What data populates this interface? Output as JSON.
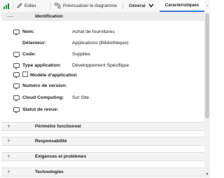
{
  "toolbar": {
    "edit_label": "Editer",
    "preview_label": "Prévisualiser le diagramme",
    "general_label": "Général",
    "characteristics_label": "Caractéristiques",
    "next_arrow": "›"
  },
  "sections": {
    "identification": {
      "title": "Identification",
      "sign": "—"
    },
    "perimetre": {
      "title": "Périmètre fonctionnel",
      "sign": "+"
    },
    "responsabilite": {
      "title": "Responsabilité",
      "sign": "+"
    },
    "exigences": {
      "title": "Exigences et problèmes",
      "sign": "+"
    },
    "technologies": {
      "title": "Technologies",
      "sign": "+"
    }
  },
  "fields": {
    "nom": {
      "label": "Nom:",
      "value": "Achat de fournitures"
    },
    "detenteur": {
      "label": "Détenteur:",
      "value": "Applications  (Bibliothèque)"
    },
    "code": {
      "label": "Code:",
      "value": "Supplies"
    },
    "type": {
      "label": "Type application:",
      "value": "Développement Spécifique"
    },
    "modele": {
      "label": "Modèle d'application",
      "checked": false
    },
    "version": {
      "label": "Numéro de version:",
      "value": ""
    },
    "cloud": {
      "label": "Cloud Computing:",
      "value": "Sur Site"
    },
    "statut": {
      "label": "Statut de revue:",
      "value": ""
    }
  },
  "icons": {
    "chart": "bar-chart-icon",
    "edit": "pencil-icon",
    "preview": "diagram-icon",
    "dropdown": "chevron-down-icon",
    "comment": "comment-icon"
  },
  "colors": {
    "accent": "#3b7bd4",
    "chart_green": "#2e9e3f",
    "header_bg": "#ececec"
  }
}
